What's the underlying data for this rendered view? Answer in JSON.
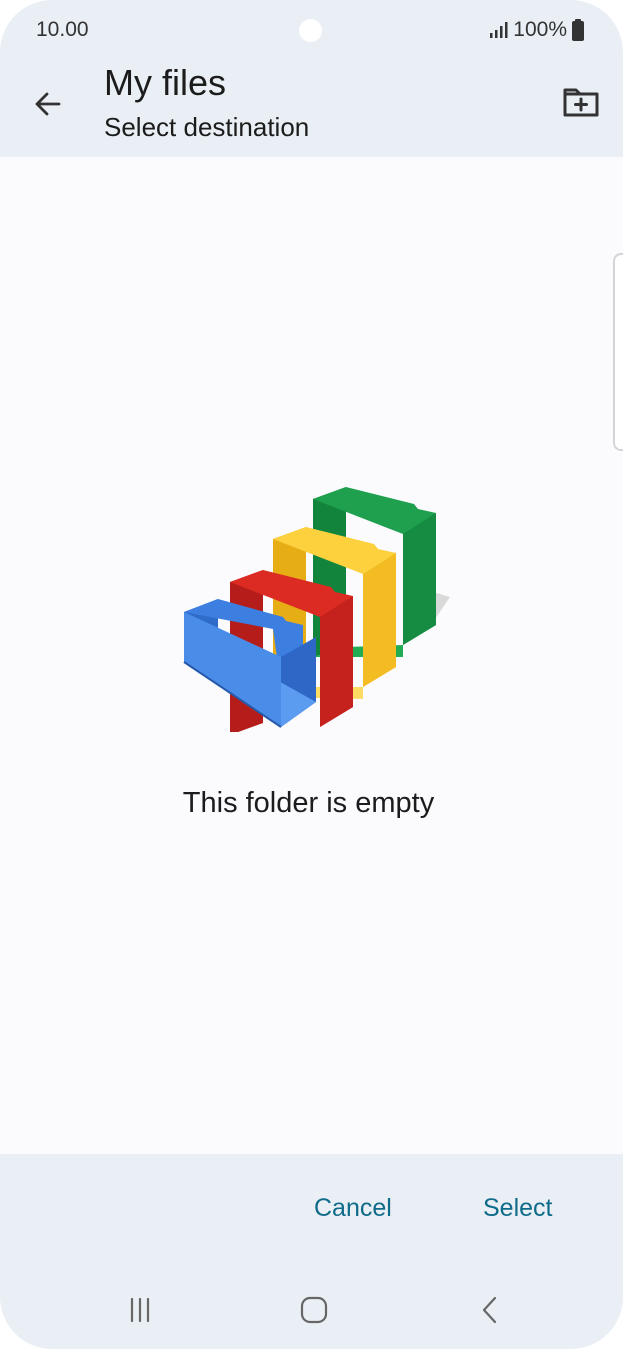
{
  "status_bar": {
    "time": "10.00",
    "battery": "100%",
    "icons": [
      "signal-icon",
      "battery-icon"
    ]
  },
  "app_bar": {
    "title": "My files",
    "subtitle": "Select destination",
    "icons": [
      "back-arrow-icon",
      "new-folder-icon"
    ]
  },
  "content": {
    "empty_message": "This folder is empty",
    "illustration": "empty-folders-illustration",
    "illustration_colors": [
      "#1a9a47",
      "#fcc934",
      "#d93025",
      "#4285f4"
    ]
  },
  "actions": {
    "cancel_label": "Cancel",
    "select_label": "Select",
    "accent_color": "#0f6b8a"
  },
  "nav_bar": {
    "icons": [
      "recents-icon",
      "home-icon",
      "back-icon"
    ]
  }
}
